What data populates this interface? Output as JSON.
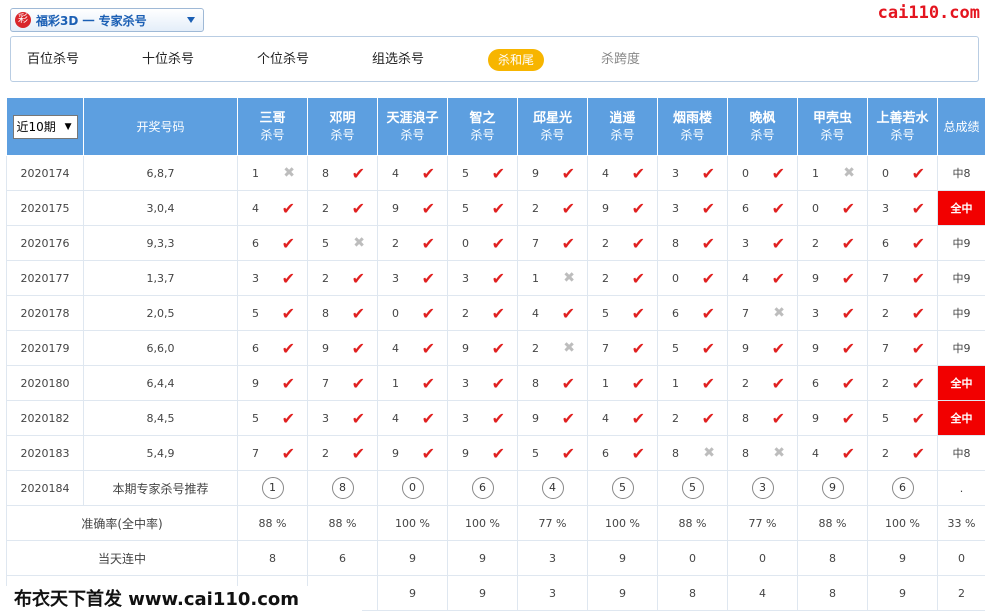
{
  "header": {
    "lottery_select": "福彩3D 一 专家杀号",
    "brand": "cai110.com"
  },
  "tabs": [
    "百位杀号",
    "十位杀号",
    "个位杀号",
    "组选杀号",
    "杀和尾",
    "杀跨度"
  ],
  "active_tab_index": 4,
  "table": {
    "period_select": "近10期",
    "draw_header": "开奖号码",
    "expert_sub": "杀号",
    "total_header": "总成绩",
    "experts": [
      "三哥",
      "邓明",
      "天涯浪子",
      "智之",
      "邱星光",
      "逍遥",
      "烟雨楼",
      "晚枫",
      "甲壳虫",
      "上善若水"
    ],
    "rows": [
      {
        "period": "2020174",
        "draw": "6,8,7",
        "kills": [
          "1",
          "8",
          "4",
          "5",
          "9",
          "4",
          "3",
          "0",
          "1",
          "0"
        ],
        "hits": [
          false,
          true,
          true,
          true,
          true,
          true,
          true,
          true,
          false,
          true
        ],
        "result": "中8",
        "full": false
      },
      {
        "period": "2020175",
        "draw": "3,0,4",
        "kills": [
          "4",
          "2",
          "9",
          "5",
          "2",
          "9",
          "3",
          "6",
          "0",
          "3"
        ],
        "hits": [
          true,
          true,
          true,
          true,
          true,
          true,
          true,
          true,
          true,
          true
        ],
        "result": "全中",
        "full": true
      },
      {
        "period": "2020176",
        "draw": "9,3,3",
        "kills": [
          "6",
          "5",
          "2",
          "0",
          "7",
          "2",
          "8",
          "3",
          "2",
          "6"
        ],
        "hits": [
          true,
          false,
          true,
          true,
          true,
          true,
          true,
          true,
          true,
          true
        ],
        "result": "中9",
        "full": false
      },
      {
        "period": "2020177",
        "draw": "1,3,7",
        "kills": [
          "3",
          "2",
          "3",
          "3",
          "1",
          "2",
          "0",
          "4",
          "9",
          "7"
        ],
        "hits": [
          true,
          true,
          true,
          true,
          false,
          true,
          true,
          true,
          true,
          true
        ],
        "result": "中9",
        "full": false
      },
      {
        "period": "2020178",
        "draw": "2,0,5",
        "kills": [
          "5",
          "8",
          "0",
          "2",
          "4",
          "5",
          "6",
          "7",
          "3",
          "2"
        ],
        "hits": [
          true,
          true,
          true,
          true,
          true,
          true,
          true,
          false,
          true,
          true
        ],
        "result": "中9",
        "full": false
      },
      {
        "period": "2020179",
        "draw": "6,6,0",
        "kills": [
          "6",
          "9",
          "4",
          "9",
          "2",
          "7",
          "5",
          "9",
          "9",
          "7"
        ],
        "hits": [
          true,
          true,
          true,
          true,
          false,
          true,
          true,
          true,
          true,
          true
        ],
        "result": "中9",
        "full": false
      },
      {
        "period": "2020180",
        "draw": "6,4,4",
        "kills": [
          "9",
          "7",
          "1",
          "3",
          "8",
          "1",
          "1",
          "2",
          "6",
          "2"
        ],
        "hits": [
          true,
          true,
          true,
          true,
          true,
          true,
          true,
          true,
          true,
          true
        ],
        "result": "全中",
        "full": true
      },
      {
        "period": "2020182",
        "draw": "8,4,5",
        "kills": [
          "5",
          "3",
          "4",
          "3",
          "9",
          "4",
          "2",
          "8",
          "9",
          "5"
        ],
        "hits": [
          true,
          true,
          true,
          true,
          true,
          true,
          true,
          true,
          true,
          true
        ],
        "result": "全中",
        "full": true
      },
      {
        "period": "2020183",
        "draw": "5,4,9",
        "kills": [
          "7",
          "2",
          "9",
          "9",
          "5",
          "6",
          "8",
          "8",
          "4",
          "2"
        ],
        "hits": [
          true,
          true,
          true,
          true,
          true,
          true,
          false,
          false,
          true,
          true
        ],
        "result": "中8",
        "full": false
      }
    ],
    "recommend": {
      "period": "2020184",
      "label": "本期专家杀号推荐",
      "values": [
        "1",
        "8",
        "0",
        "6",
        "4",
        "5",
        "5",
        "3",
        "9",
        "6"
      ],
      "total": "."
    },
    "accuracy": {
      "label": "准确率(全中率)",
      "values": [
        "88 %",
        "88 %",
        "100 %",
        "100 %",
        "77 %",
        "100 %",
        "88 %",
        "77 %",
        "88 %",
        "100 %"
      ],
      "total": "33 %"
    },
    "streak": {
      "label": "当天连中",
      "values": [
        "8",
        "6",
        "9",
        "9",
        "3",
        "9",
        "0",
        "0",
        "8",
        "9"
      ],
      "total": "0"
    },
    "last_row": {
      "values": [
        "9",
        "9",
        "3",
        "9",
        "8",
        "4",
        "8",
        "9"
      ],
      "total": "2"
    }
  },
  "footer_watermark": "布衣天下首发 www.cai110.com",
  "colors": {
    "header_blue": "#5d9fe0",
    "hit_red": "#e02020",
    "full_red": "#f20000",
    "active_tab": "#f7b500",
    "stat_bg": "#fff8d8"
  }
}
